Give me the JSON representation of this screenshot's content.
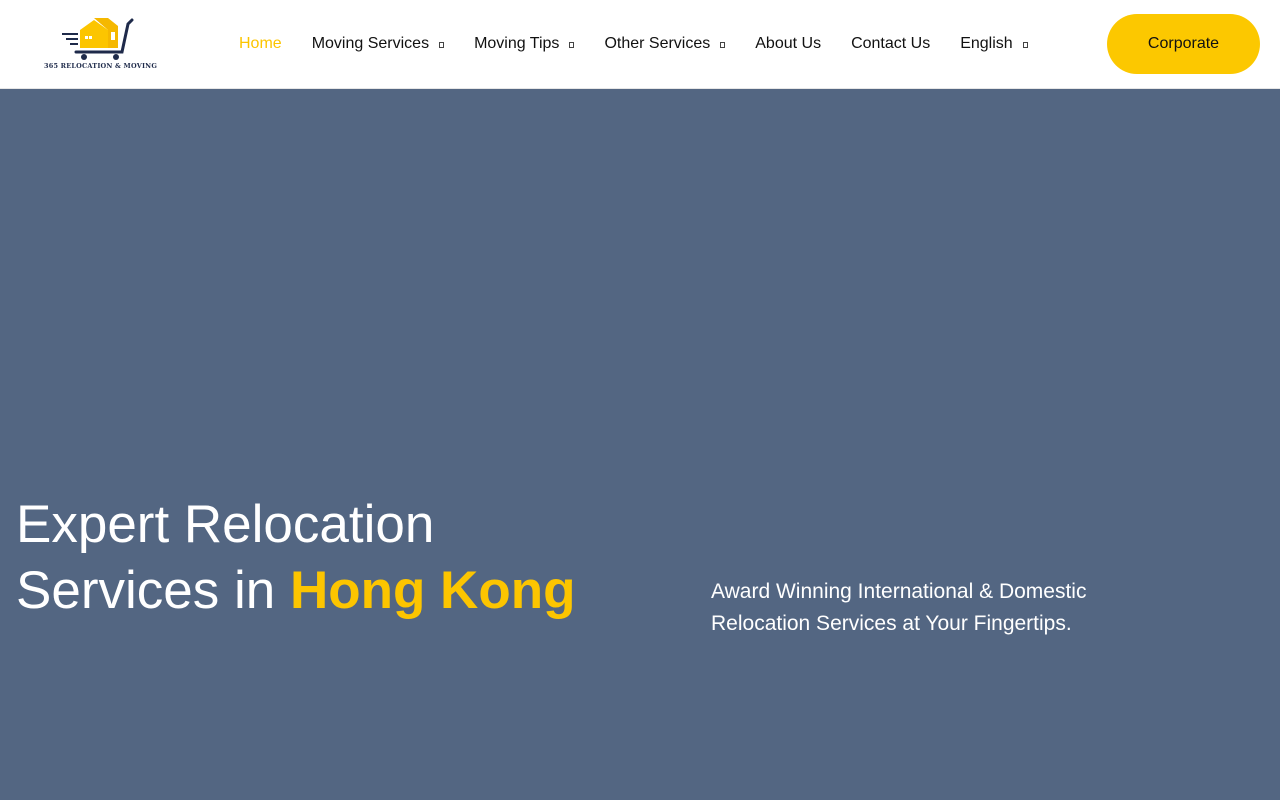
{
  "header": {
    "logo": {
      "text": "365 RELOCATION & MOVING",
      "icon": "moving-cart-house-icon",
      "colors": {
        "house": "#fcc500",
        "cart": "#1e2a4a"
      }
    },
    "nav": {
      "items": [
        {
          "label": "Home",
          "active": true,
          "has_dropdown": false
        },
        {
          "label": "Moving Services",
          "active": false,
          "has_dropdown": true
        },
        {
          "label": "Moving Tips",
          "active": false,
          "has_dropdown": true
        },
        {
          "label": "Other Services",
          "active": false,
          "has_dropdown": true
        },
        {
          "label": "About Us",
          "active": false,
          "has_dropdown": false
        },
        {
          "label": "Contact Us",
          "active": false,
          "has_dropdown": false
        },
        {
          "label": "English",
          "active": false,
          "has_dropdown": true
        }
      ]
    },
    "cta": {
      "label": "Corporate"
    }
  },
  "hero": {
    "title_line1": "Expert Relocation",
    "title_line2_prefix": "Services in ",
    "title_line2_highlight": "Hong Kong",
    "subtitle_line1": "Award Winning International & Domestic",
    "subtitle_line2": "Relocation Services at Your Fingertips."
  },
  "colors": {
    "accent": "#fcc500",
    "hero_background": "#536682",
    "nav_text": "#111111",
    "header_background": "#ffffff"
  }
}
